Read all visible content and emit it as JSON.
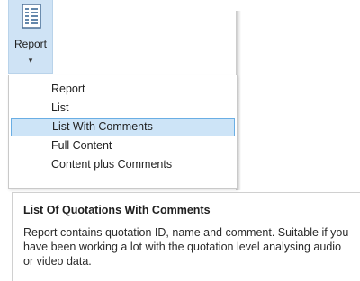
{
  "ribbon": {
    "report_button_label": "Report",
    "report_button_icon": "document-lines-icon",
    "dropdown_indicator": "▾"
  },
  "menu": {
    "items": [
      {
        "label": "Report",
        "selected": false
      },
      {
        "label": "List",
        "selected": false
      },
      {
        "label": "List With Comments",
        "selected": true
      },
      {
        "label": "Full Content",
        "selected": false
      },
      {
        "label": "Content plus Comments",
        "selected": false
      }
    ]
  },
  "tooltip": {
    "title": "List Of Quotations With Comments",
    "body": "Report contains quotation ID, name and comment. Suitable if you have been working a lot with the quotation level analysing audio or video data."
  },
  "colors": {
    "selected_bg": "#cde4f7",
    "selected_border": "#6aaee4",
    "ribbon_active_bg": "#cfe3f5"
  }
}
